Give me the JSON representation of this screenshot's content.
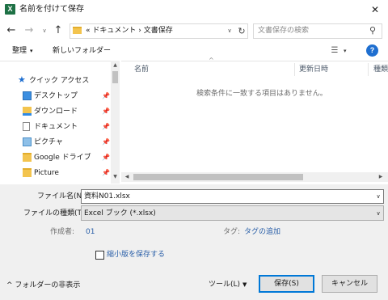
{
  "window": {
    "title": "名前を付けて保存",
    "app_icon_letter": "X",
    "close_label": "✕"
  },
  "address": {
    "back_icon": "←",
    "forward_icon": "→",
    "recent_icon": "∨",
    "up_icon": "↑",
    "breadcrumb": "« ドキュメント › 文書保存",
    "dropdown_icon": "∨",
    "refresh_icon": "↻"
  },
  "search": {
    "placeholder": "文書保存の検索",
    "icon": "⚲"
  },
  "toolbar": {
    "organize_label": "整理",
    "organize_caret": "▾",
    "new_folder_label": "新しいフォルダー",
    "view_icon": "☰",
    "view_caret": "▾",
    "help_label": "?"
  },
  "sidebar": {
    "items": [
      {
        "label": "クイック アクセス",
        "icon": "star-icon",
        "pinned": false
      },
      {
        "label": "デスクトップ",
        "icon": "desktop-icon",
        "pinned": true
      },
      {
        "label": "ダウンロード",
        "icon": "download-icon",
        "pinned": true
      },
      {
        "label": "ドキュメント",
        "icon": "document-icon",
        "pinned": true
      },
      {
        "label": "ピクチャ",
        "icon": "picture-icon",
        "pinned": true
      },
      {
        "label": "Google ドライブ",
        "icon": "folder-icon",
        "pinned": true
      },
      {
        "label": "Picture",
        "icon": "folder-icon",
        "pinned": true
      }
    ],
    "pin_glyph": "📌",
    "scroll_up": "▲",
    "scroll_down": "▼"
  },
  "filelist": {
    "sort_indicator": "^",
    "columns": [
      "名前",
      "更新日時",
      "種類"
    ],
    "empty_message": "検索条件に一致する項目はありません。",
    "scroll_left": "◀",
    "scroll_right": "▶"
  },
  "form": {
    "filename_label": "ファイル名(N):",
    "filename_value": "資料N01.xlsx",
    "filetype_label": "ファイルの種類(T):",
    "filetype_value": "Excel ブック (*.xlsx)",
    "dropdown_icon": "∨",
    "author_label": "作成者:",
    "author_value": "01",
    "tag_label": "タグ:",
    "tag_value": "タグの追加",
    "thumbnail_label": "縮小版を保存する",
    "thumbnail_checked": false
  },
  "footer": {
    "hide_folders_label": "^ フォルダーの非表示",
    "tools_label": "ツール(L)",
    "tools_caret": "▼",
    "save_label": "保存(S)",
    "cancel_label": "キャンセル"
  },
  "colors": {
    "excel_green": "#1e7145",
    "link_blue": "#2a5fa8",
    "help_blue": "#1f6fd0",
    "focus_blue": "#0078d7",
    "folder_yellow": "#f3c44e"
  }
}
